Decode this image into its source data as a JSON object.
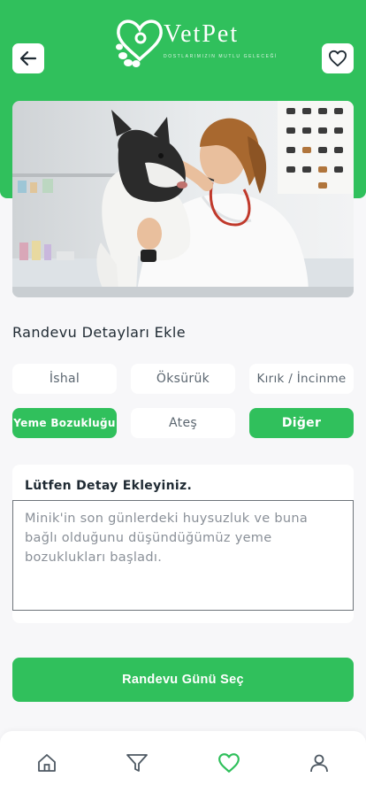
{
  "header": {
    "brand": "VetPet",
    "tagline": "DOSTLARIMIZIN MUTLU GELECEĞİ"
  },
  "section_title": "Randevu Detayları Ekle",
  "symptoms": [
    {
      "label": "İshal",
      "selected": false
    },
    {
      "label": "Öksürük",
      "selected": false
    },
    {
      "label": "Kırık / İncinme",
      "selected": false
    },
    {
      "label": "Yeme Bozukluğu",
      "selected": true
    },
    {
      "label": "Ateş",
      "selected": false
    },
    {
      "label": "Diğer",
      "selected": true
    }
  ],
  "details": {
    "label": "Lütfen Detay Ekleyiniz.",
    "value": "Minik'in son günlerdeki huysuzluk ve buna bağlı olduğunu düşündüğümüz yeme bozuklukları başladı."
  },
  "cta_label": "Randevu Günü Seç",
  "tabs": [
    {
      "icon": "home-icon",
      "active": false
    },
    {
      "icon": "filter-icon",
      "active": false
    },
    {
      "icon": "heart-icon",
      "active": true
    },
    {
      "icon": "user-icon",
      "active": false
    }
  ],
  "colors": {
    "accent": "#30c05c",
    "background": "#f7f7f9",
    "icon_inactive": "#4d5862"
  }
}
